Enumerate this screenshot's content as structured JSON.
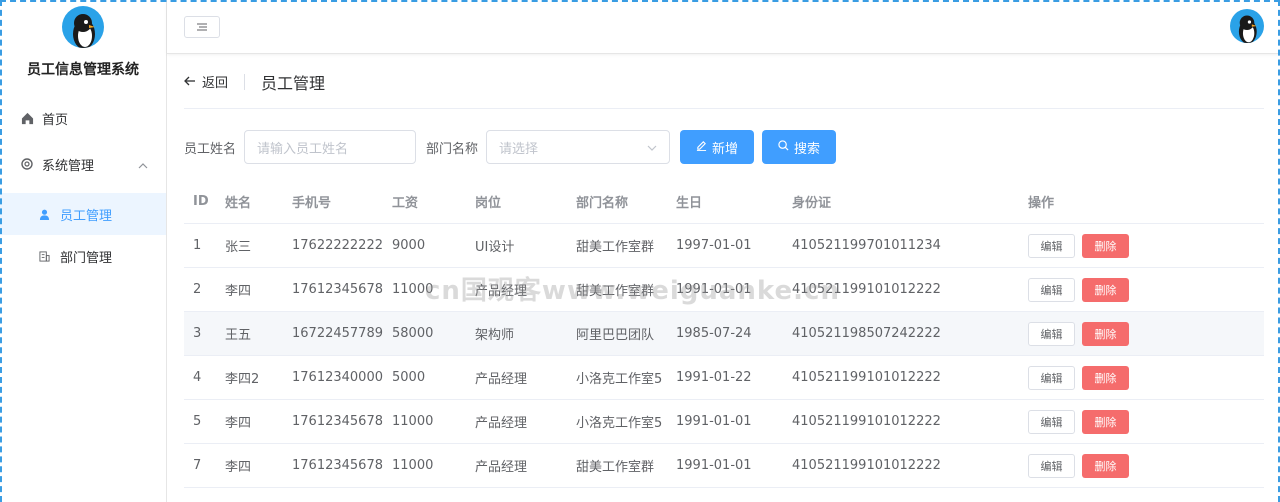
{
  "sidebar": {
    "title": "员工信息管理系统",
    "menu": [
      {
        "label": "首页",
        "icon": "home-icon"
      },
      {
        "label": "系统管理",
        "icon": "gear-icon",
        "expanded": true
      }
    ],
    "submenu": [
      {
        "label": "员工管理",
        "icon": "user-icon",
        "active": true
      },
      {
        "label": "部门管理",
        "icon": "building-icon",
        "active": false
      }
    ]
  },
  "page_header": {
    "back_label": "返回",
    "title": "员工管理"
  },
  "search": {
    "name_label": "员工姓名",
    "name_placeholder": "请输入员工姓名",
    "dept_label": "部门名称",
    "dept_placeholder": "请选择",
    "add_label": "新增",
    "search_label": "搜索"
  },
  "table": {
    "columns": [
      "ID",
      "姓名",
      "手机号",
      "工资",
      "岗位",
      "部门名称",
      "生日",
      "身份证",
      "操作"
    ],
    "edit_label": "编辑",
    "delete_label": "删除",
    "rows": [
      {
        "id": "1",
        "name": "张三",
        "phone": "17622222222",
        "salary": "9000",
        "post": "UI设计",
        "dept": "甜美工作室群",
        "birth": "1997-01-01",
        "idcard": "410521199701011234"
      },
      {
        "id": "2",
        "name": "李四",
        "phone": "17612345678",
        "salary": "11000",
        "post": "产品经理",
        "dept": "甜美工作室群",
        "birth": "1991-01-01",
        "idcard": "410521199101012222"
      },
      {
        "id": "3",
        "name": "王五",
        "phone": "16722457789",
        "salary": "58000",
        "post": "架构师",
        "dept": "阿里巴巴团队",
        "birth": "1985-07-24",
        "idcard": "410521198507242222"
      },
      {
        "id": "4",
        "name": "李四2",
        "phone": "17612340000",
        "salary": "5000",
        "post": "产品经理",
        "dept": "小洛克工作室5",
        "birth": "1991-01-22",
        "idcard": "410521199101012222"
      },
      {
        "id": "5",
        "name": "李四",
        "phone": "17612345678",
        "salary": "11000",
        "post": "产品经理",
        "dept": "小洛克工作室5",
        "birth": "1991-01-01",
        "idcard": "410521199101012222"
      },
      {
        "id": "7",
        "name": "李四",
        "phone": "17612345678",
        "salary": "11000",
        "post": "产品经理",
        "dept": "甜美工作室群",
        "birth": "1991-01-01",
        "idcard": "410521199101012222"
      }
    ]
  },
  "watermark": "cn国观客www.weiguanke.cn",
  "colors": {
    "primary": "#409eff",
    "danger": "#f56c6c",
    "active_bg": "#ecf5ff"
  }
}
